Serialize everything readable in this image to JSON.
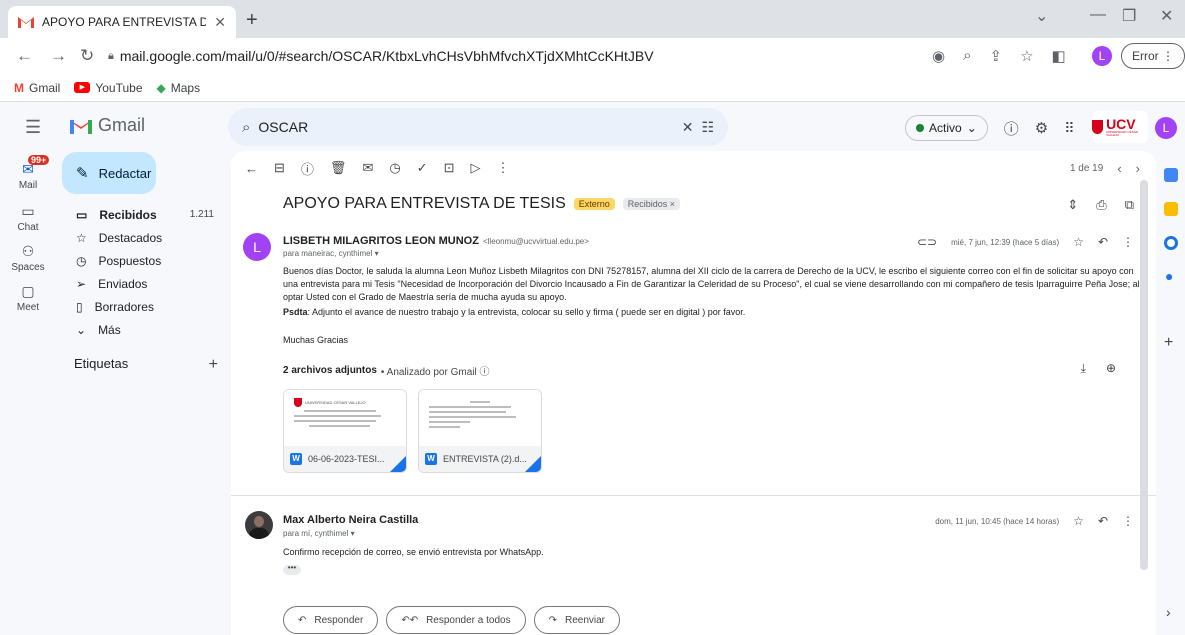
{
  "browser": {
    "tab_title": "APOYO PARA ENTREVISTA DE TE",
    "url": "mail.google.com/mail/u/0/#search/OSCAR/KtbxLvhCHsVbhMfvchXTjdXMhtCcKHtJBV",
    "error_label": "Error",
    "profile_initial": "L",
    "bookmarks": [
      "Gmail",
      "YouTube",
      "Maps"
    ]
  },
  "gmail": {
    "logo_text": "Gmail",
    "search_value": "OSCAR",
    "status": "Activo",
    "avatar_initial": "L",
    "ucv_logo": "UCV",
    "ucv_tagline": "UNIVERSIDAD CÉSAR VALLEJO"
  },
  "rail": {
    "mail": "Mail",
    "mail_badge": "99+",
    "chat": "Chat",
    "spaces": "Spaces",
    "meet": "Meet"
  },
  "nav": {
    "compose": "Redactar",
    "items": [
      {
        "label": "Recibidos",
        "count": "1.211"
      },
      {
        "label": "Destacados"
      },
      {
        "label": "Pospuestos"
      },
      {
        "label": "Enviados"
      },
      {
        "label": "Borradores"
      },
      {
        "label": "Más"
      }
    ],
    "labels_title": "Etiquetas"
  },
  "thread": {
    "pager": "1 de 19",
    "subject": "APOYO PARA ENTREVISTA DE TESIS",
    "label_external": "Externo",
    "label_inbox": "Recibidos ×",
    "msg1": {
      "avatar_initial": "L",
      "sender": "LISBETH MILAGRITOS LEON MUNOZ",
      "email": "<lleonmu@ucvvirtual.edu.pe>",
      "to": "para maneirac, cynthimel ▾",
      "date": "mié, 7 jun, 12:39 (hace 5 días)",
      "body": "Buenos días Doctor, le saluda la alumna Leon Muñoz Lisbeth Milagritos con DNI 75278157, alumna del XII ciclo de la carrera de Derecho de la UCV, le escribo el siguiente correo con el fin de solicitar su apoyo con una entrevista para mi Tesis \"Necesidad de Incorporación del Divorcio Incausado a Fin de Garantizar la Celeridad de su Proceso\", el cual se viene desarrollando con mi compañero de tesis Iparraguirre Peña Jose; al optar Usted con el Grado de Maestría sería de mucha ayuda su apoyo.",
      "psdta_label": "Psdta",
      "psdta_text": ": Adjunto  el avance de nuestro trabajo y la  entrevista,  colocar su sello y firma ( puede ser en digital ) por favor.",
      "closing": "Muchas Gracias",
      "attachments_title": "2 archivos adjuntos",
      "attachments_scan": "• Analizado por Gmail ⓘ",
      "attachments": [
        {
          "name": "06-06-2023-TESI...",
          "preview_title": "UNIVERSIDAD CÉSAR VALLEJO"
        },
        {
          "name": "ENTREVISTA (2).d..."
        }
      ]
    },
    "msg2": {
      "sender": "Max Alberto Neira Castilla",
      "to": "para mí, cynthimel ▾",
      "date": "dom, 11 jun, 10:45 (hace 14 horas)",
      "body": "Confirmo recepción de correo, se envió entrevista por WhatsApp."
    },
    "actions": {
      "reply": "Responder",
      "reply_all": "Responder a todos",
      "forward": "Reenviar"
    }
  }
}
